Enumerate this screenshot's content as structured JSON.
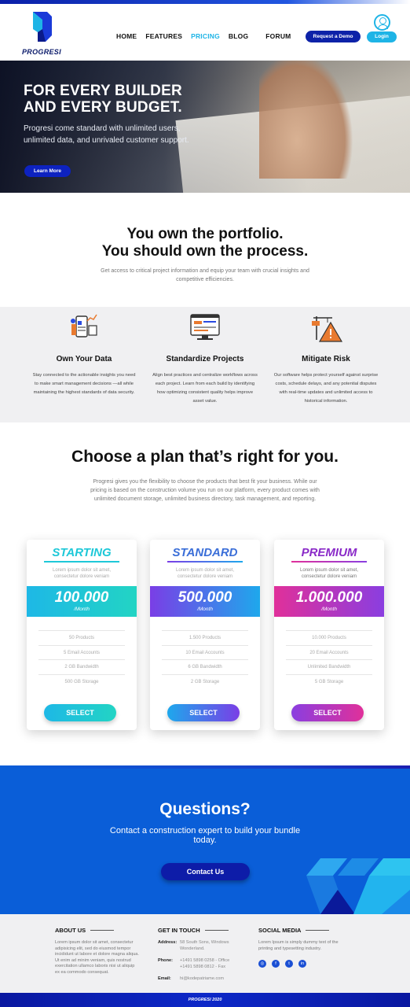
{
  "brand": {
    "name": "PROGRESI",
    "primary": "#0d22a8",
    "accent": "#1eb4e6"
  },
  "nav": {
    "items": [
      {
        "label": "HOME",
        "active": false
      },
      {
        "label": "FEATURES",
        "active": false
      },
      {
        "label": "PRICING",
        "active": true
      },
      {
        "label": "BLOG",
        "active": false
      },
      {
        "label": "FORUM",
        "active": false
      }
    ],
    "demo_label": "Request a Demo",
    "login_label": "Login"
  },
  "hero": {
    "title_line1": "FOR EVERY BUILDER",
    "title_line2": "AND EVERY BUDGET.",
    "subtitle": "Progresi come standard with unlimited users, unlimited data, and unrivaled customer support.",
    "cta_label": "Learn More"
  },
  "portfolio": {
    "title_line1": "You own the portfolio.",
    "title_line2": "You should own the process.",
    "text": "Get access to critical project information and equip your team with crucial insights and competitive efficiencies."
  },
  "features": [
    {
      "icon": "mobile-data-icon",
      "title": "Own Your Data",
      "text": "Stay connected to the actionable insights you need to make smart management decisions —all while maintaining the highest standards of data security."
    },
    {
      "icon": "workflow-monitor-icon",
      "title": "Standardize Projects",
      "text": "Align best practices and centralize workflows across each project. Learn from each build by identifying how optimizing consistent quality helps improve asset value."
    },
    {
      "icon": "warning-crane-icon",
      "title": "Mitigate Risk",
      "text": "Our software helps protect yourself against surprise costs, schedule delays, and any potential disputes with real-time updates and unlimited access to historical information."
    }
  ],
  "plans_section": {
    "title": "Choose a plan that’s right for you.",
    "text": "Progresi gives you the flexibility to choose the products that best fit your business. While our pricing is based on the construction volume you run on our platform, every product comes with unlimited document storage, unlimited business directory, task management, and reporting."
  },
  "plans": [
    {
      "name": "STARTING",
      "desc": "Lorem ipsum dolor sit amet, consectetur dolore veniam",
      "price": "100.000",
      "period": "/Month",
      "features": [
        "50 Products",
        "5 Email Accounts",
        "2 GB Bandwidth",
        "500 GB Storage"
      ],
      "button": "SELECT",
      "color": "#1ec8d8",
      "gradient": [
        "#1eb8e6",
        "#22d4c4"
      ]
    },
    {
      "name": "STANDARD",
      "desc": "Lorem ipsum dolor sit amet, consectetur dolore veniam",
      "price": "500.000",
      "period": "/Month",
      "features": [
        "1.500 Products",
        "10 Email Accounts",
        "6 GB Bandwidth",
        "2 GB Storage"
      ],
      "button": "SELECT",
      "color": "#3a6ed8",
      "gradient": [
        "#7a3ee6",
        "#1ea8ec"
      ]
    },
    {
      "name": "PREMIUM",
      "desc": "Lorem ipsum dolor sit amet, consectetur dolore veniam",
      "price": "1.000.000",
      "period": "/Month",
      "features": [
        "10.000 Products",
        "20 Email Accounts",
        "Unlimited Bandwidth",
        "5 GB Storage"
      ],
      "button": "SELECT",
      "color": "#8a2ac8",
      "gradient": [
        "#e0309a",
        "#8a3ee0"
      ]
    }
  ],
  "questions": {
    "title": "Questions?",
    "text": "Contact a construction expert to build your bundle today.",
    "cta_label": "Contact Us"
  },
  "footer": {
    "about": {
      "title": "ABOUT US",
      "text": "Lorem ipsum dolor sit amet, consectetur adipisicing elit, sed do eiusmod tempor incididunt ut labore et dolore magna aliqua. Ut enim ad minim veniam, quis nostrud exercitation ullamco laboris nisi ut aliquip ex ea commodo consequat."
    },
    "contact": {
      "title": "GET IN TOUCH",
      "address_label": "Address:",
      "address": "58 South Sons, Windows Wonderland.",
      "phone_label": "Phone:",
      "phone": "+1491 5898 0258 - Office +1491 5898 0812 - Fax",
      "email_label": "Email:",
      "email": "hi@kodepatriame.com"
    },
    "social": {
      "title": "SOCIAL MEDIA",
      "text": "Lorem Ipsum is simply dummy text of the printing and typesetting industry.",
      "icons": [
        "instagram-icon",
        "facebook-icon",
        "twitter-icon",
        "linkedin-icon"
      ]
    },
    "copyright": "PROGRESI 2020"
  }
}
